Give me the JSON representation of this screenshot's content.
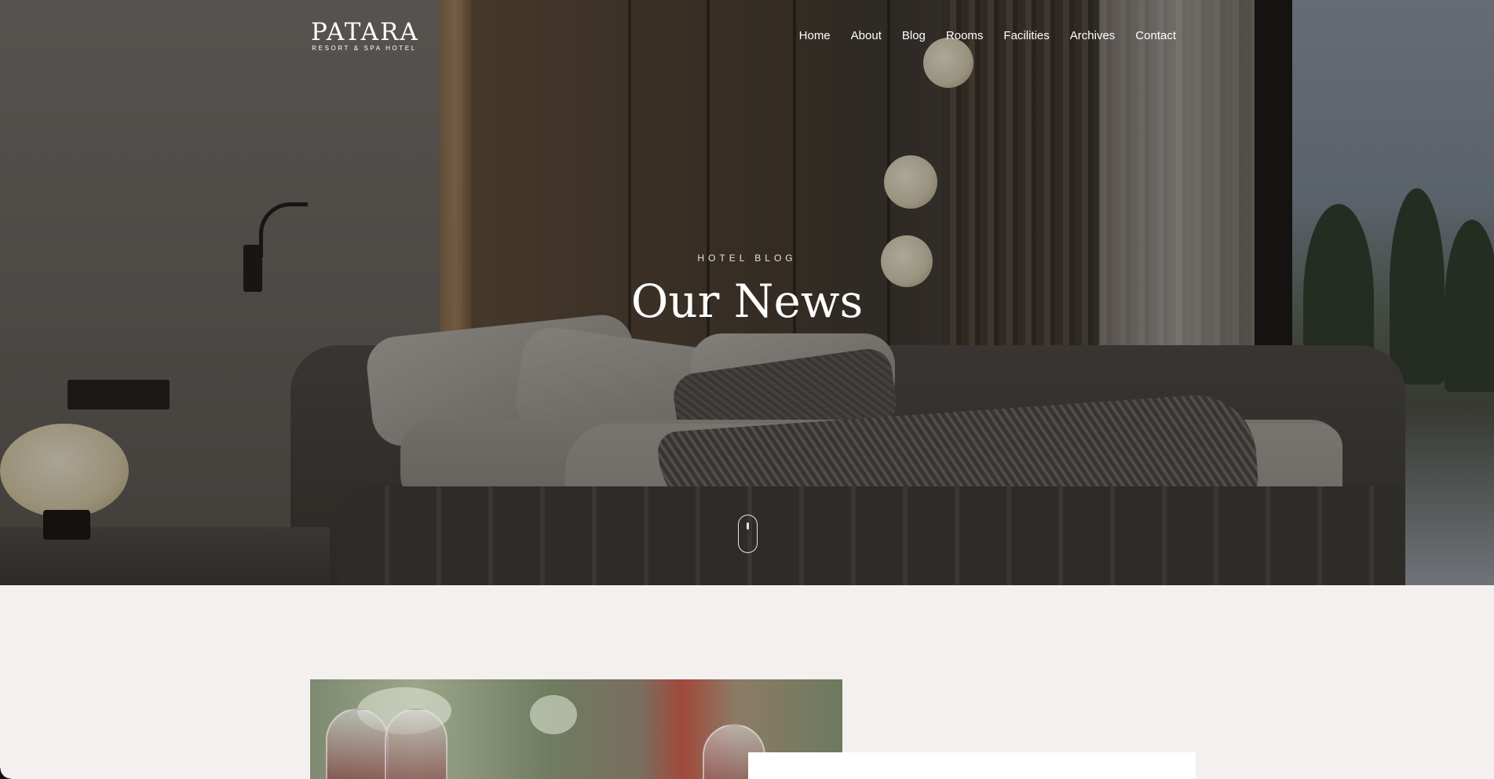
{
  "logo": {
    "name": "PATARA",
    "tagline": "RESORT & SPA HOTEL"
  },
  "nav": {
    "items": [
      {
        "label": "Home"
      },
      {
        "label": "About"
      },
      {
        "label": "Blog"
      },
      {
        "label": "Rooms"
      },
      {
        "label": "Facilities"
      },
      {
        "label": "Archives"
      },
      {
        "label": "Contact"
      }
    ]
  },
  "hero": {
    "eyebrow": "HOTEL BLOG",
    "title": "Our News"
  },
  "icons": {
    "scroll": "mouse-scroll-icon"
  },
  "colors": {
    "page_background": "#f4f0f0",
    "hero_text": "#ffffff",
    "card_background": "#ffffff"
  }
}
